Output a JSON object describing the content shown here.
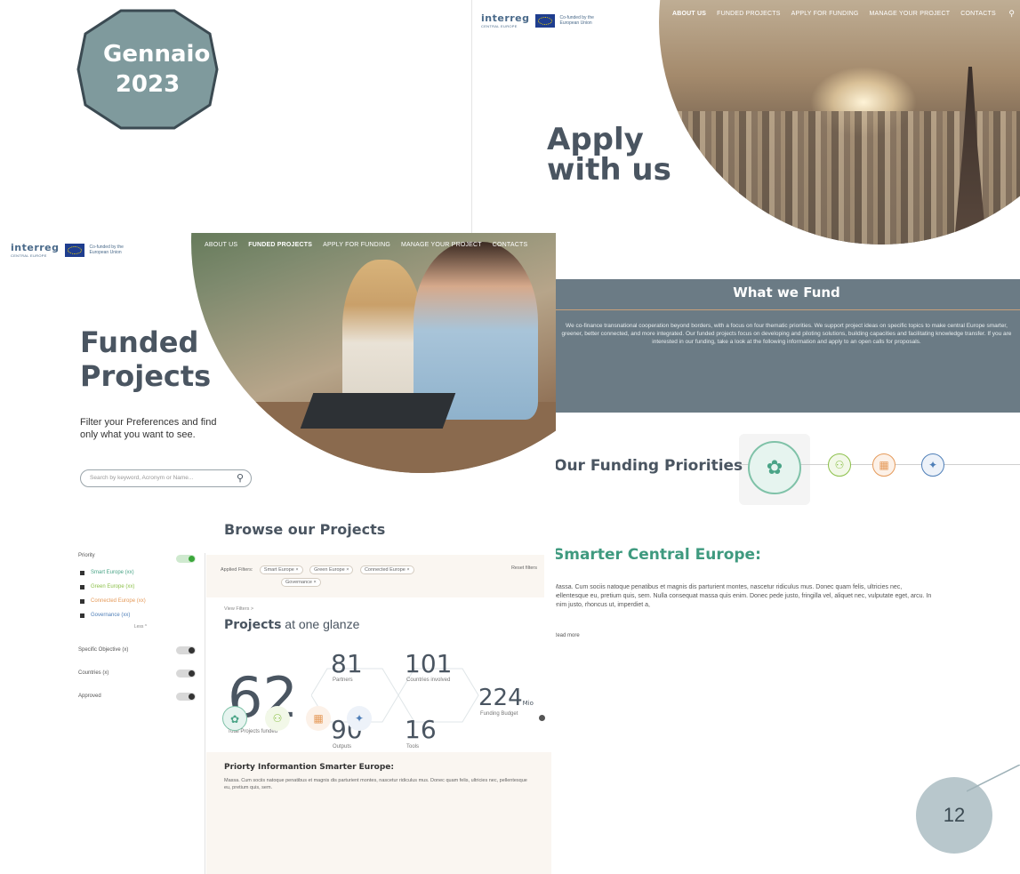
{
  "slide": {
    "month_badge": "Gennaio 2023",
    "page_number": "12"
  },
  "logo": {
    "word": "interreg",
    "sub": "CENTRAL EUROPE",
    "cofund": "Co-funded by the European Union"
  },
  "nav": [
    "ABOUT US",
    "FUNDED PROJECTS",
    "APPLY FOR FUNDING",
    "MANAGE YOUR PROJECT",
    "CONTACTS"
  ],
  "apply": {
    "title_line1": "Apply",
    "title_line2": "with us"
  },
  "what_we_fund": {
    "title": "What we Fund",
    "body": "We co-finance transnational cooperation beyond borders, with a focus on four thematic priorities. We support project ideas on specific topics to make central Europe smarter, greener, better connected, and more integrated. Our funded projects focus on developing and piloting solutions, building capacities and facilitating knowledge transfer. If you are interested in our funding, take a look at the following information and apply to an open calls for proposals."
  },
  "priorities": {
    "title": "Our Funding Priorities",
    "icons": [
      "brain-icon",
      "people-icon",
      "city-icon",
      "network-icon"
    ],
    "colors": {
      "smart": "#4aa487",
      "green": "#8cc04a",
      "connect": "#e59a5a",
      "integrate": "#4f7fb8"
    }
  },
  "smarter": {
    "title": "Smarter Central Europe:",
    "body": "Massa. Cum sociis natoque penatibus et magnis dis parturient montes, nascetur ridiculus mus. Donec quam felis, ultricies nec, pellentesque eu, pretium quis, sem. Nulla consequat massa quis enim. Donec pede justo, fringilla vel, aliquet nec, vulputate eget, arcu. In enim justo, rhoncus ut, imperdiet a,",
    "more": "Read more"
  },
  "funded": {
    "title_line1": "Funded",
    "title_line2": "Projects",
    "subtitle_line1": "Filter your Preferences and find",
    "subtitle_line2": "only what you want  to see.",
    "search_placeholder": "Search by keyword, Acronym or Name...",
    "browse_title": "Browse our Projects"
  },
  "filters": {
    "priority_label": "Priority",
    "items": [
      "Smart Europe (xx)",
      "Green Europe (xx)",
      "Connected Europe (xx)",
      "Governance (xx)"
    ],
    "less": "Less ^",
    "rows": [
      "Specific Objective (x)",
      "Countries (x)",
      "Approved"
    ]
  },
  "applied": {
    "label": "Applied Filters:",
    "chips": [
      "Smart Europe ×",
      "Green Europe ×",
      "Connected Europe ×",
      "Governance ×"
    ],
    "reset": "Reset filters"
  },
  "glance": {
    "crumb": "View Filters >",
    "title_bold": "Projects",
    "title_rest": " at one glanze",
    "total": "62",
    "total_caption": "Total Projects funded",
    "partners": "81",
    "partners_caption": "Partners",
    "countries": "101",
    "countries_caption": "Countries involved",
    "budget": "224",
    "budget_unit": "Mio",
    "budget_caption": "Funding Budget",
    "outputs": "90",
    "outputs_caption": "Outputs",
    "tools": "16",
    "tools_caption": "Tools"
  },
  "prio_info": {
    "title": "Priorty Informantion Smarter Europe:",
    "body": "Massa. Cum sociis natoque penatibus et magnis dis parturient montes, nascetur ridiculus mus. Donec quam felis, ultricies nec, pellentesque eu, pretium quis, sem."
  }
}
